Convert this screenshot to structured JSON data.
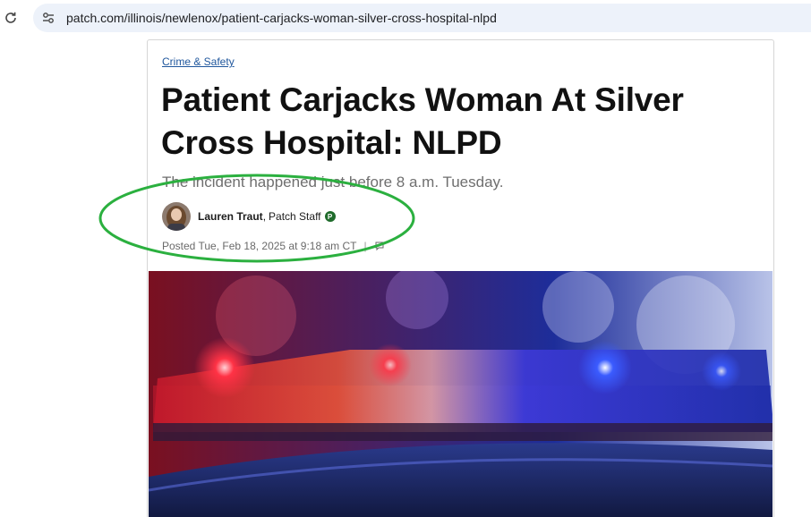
{
  "browser": {
    "url": "patch.com/illinois/newlenox/patient-carjacks-woman-silver-cross-hospital-nlpd",
    "reload_icon": "reload-icon",
    "site_info_icon": "tune-icon"
  },
  "article": {
    "category": "Crime & Safety",
    "headline": "Patient Carjacks Woman At Silver Cross Hospital: NLPD",
    "subheadline": "The incident happened just before 8 a.m. Tuesday.",
    "author": {
      "name": "Lauren Traut",
      "separator": ",",
      "role": "Patch Staff",
      "badge": "P"
    },
    "posted": "Posted Tue, Feb 18, 2025 at 9:18 am CT",
    "meta_divider": "|",
    "comment_icon": "comment-icon"
  },
  "colors": {
    "link": "#20579d",
    "badge": "#1f6b2b",
    "annotation": "#2bb03f",
    "omnibox": "#edf2fa"
  }
}
